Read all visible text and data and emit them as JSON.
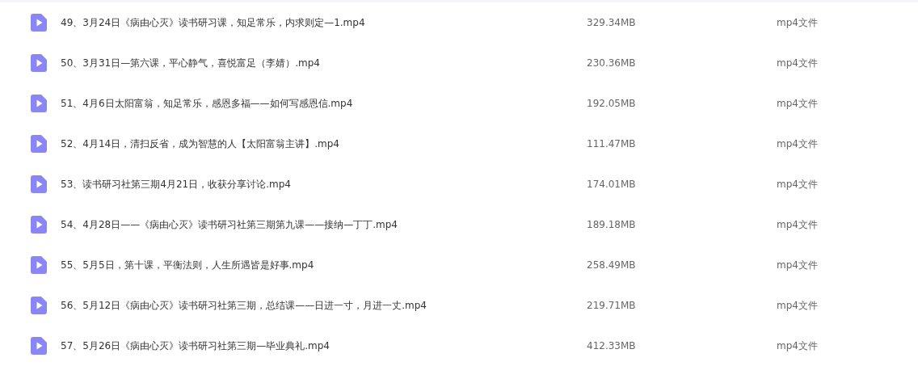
{
  "files": [
    {
      "name": "49、3月24日《病由心灭》读书研习课，知足常乐，内求则定—1.mp4",
      "size": "329.34MB",
      "type": "mp4文件"
    },
    {
      "name": "50、3月31日—第六课，平心静气，喜悦富足（李婧）.mp4",
      "size": "230.36MB",
      "type": "mp4文件"
    },
    {
      "name": "51、4月6日太阳富翁，知足常乐，感恩多福——如何写感恩信.mp4",
      "size": "192.05MB",
      "type": "mp4文件"
    },
    {
      "name": "52、4月14日，清扫反省，成为智慧的人【太阳富翁主讲】.mp4",
      "size": "111.47MB",
      "type": "mp4文件"
    },
    {
      "name": "53、读书研习社第三期4月21日，收获分享讨论.mp4",
      "size": "174.01MB",
      "type": "mp4文件"
    },
    {
      "name": "54、4月28日——《病由心灭》读书研习社第三期第九课——接纳—丁丁.mp4",
      "size": "189.18MB",
      "type": "mp4文件"
    },
    {
      "name": "55、5月5日，第十课，平衡法则，人生所遇皆是好事.mp4",
      "size": "258.49MB",
      "type": "mp4文件"
    },
    {
      "name": "56、5月12日《病由心灭》读书研习社第三期，总结课——日进一寸，月进一丈.mp4",
      "size": "219.71MB",
      "type": "mp4文件"
    },
    {
      "name": "57、5月26日《病由心灭》读书研习社第三期—毕业典礼.mp4",
      "size": "412.33MB",
      "type": "mp4文件"
    }
  ]
}
